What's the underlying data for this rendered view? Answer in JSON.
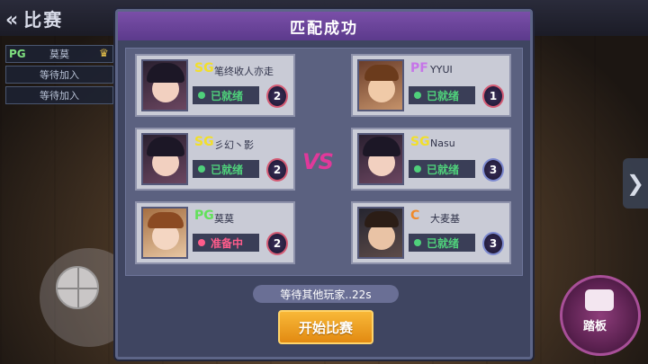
{
  "header": {
    "back_label": "比赛"
  },
  "sidebar": {
    "rows": [
      {
        "pos": "PG",
        "name": "莫莫"
      },
      {
        "pos": "",
        "name": "等待加入"
      },
      {
        "pos": "",
        "name": "等待加入"
      }
    ]
  },
  "modal": {
    "title": "匹配成功",
    "vs_label": "VS",
    "waiting_text": "等待其他玩家..22s",
    "start_button": "开始比赛"
  },
  "left_team": [
    {
      "pos": "SG",
      "pos_color": "#f2df2a",
      "name": "笔终收人亦走",
      "status": "已就绪",
      "status_color": "#4fd17b",
      "rank": "2",
      "avatar": "female-dark-hair"
    },
    {
      "pos": "SG",
      "pos_color": "#f2df2a",
      "name": "彡幻丶影",
      "status": "已就绪",
      "status_color": "#4fd17b",
      "rank": "2",
      "avatar": "female-dark-hair"
    },
    {
      "pos": "PG",
      "pos_color": "#62e05a",
      "name": "莫莫",
      "status": "准备中",
      "status_color": "#ff5c8b",
      "rank": "2",
      "avatar": "female-brown-hair"
    }
  ],
  "right_team": [
    {
      "pos": "PF",
      "pos_color": "#c675e8",
      "name": "YYUI",
      "status": "已就绪",
      "status_color": "#4fd17b",
      "rank": "1",
      "avatar": "male-brown-hair"
    },
    {
      "pos": "SG",
      "pos_color": "#f2df2a",
      "name": "Nasu",
      "status": "已就绪",
      "status_color": "#4fd17b",
      "rank": "3",
      "avatar": "female-dark-hair"
    },
    {
      "pos": "C",
      "pos_color": "#f08a2a",
      "name": "大麦基",
      "status": "已就绪",
      "status_color": "#4fd17b",
      "rank": "3",
      "avatar": "male-dark-hair"
    }
  ],
  "controls": {
    "tab_label": "踏板"
  },
  "icons": [
    "back-chevron-icon",
    "crown-icon",
    "basketball-icon",
    "right-arrow-icon",
    "pedal-icon"
  ]
}
